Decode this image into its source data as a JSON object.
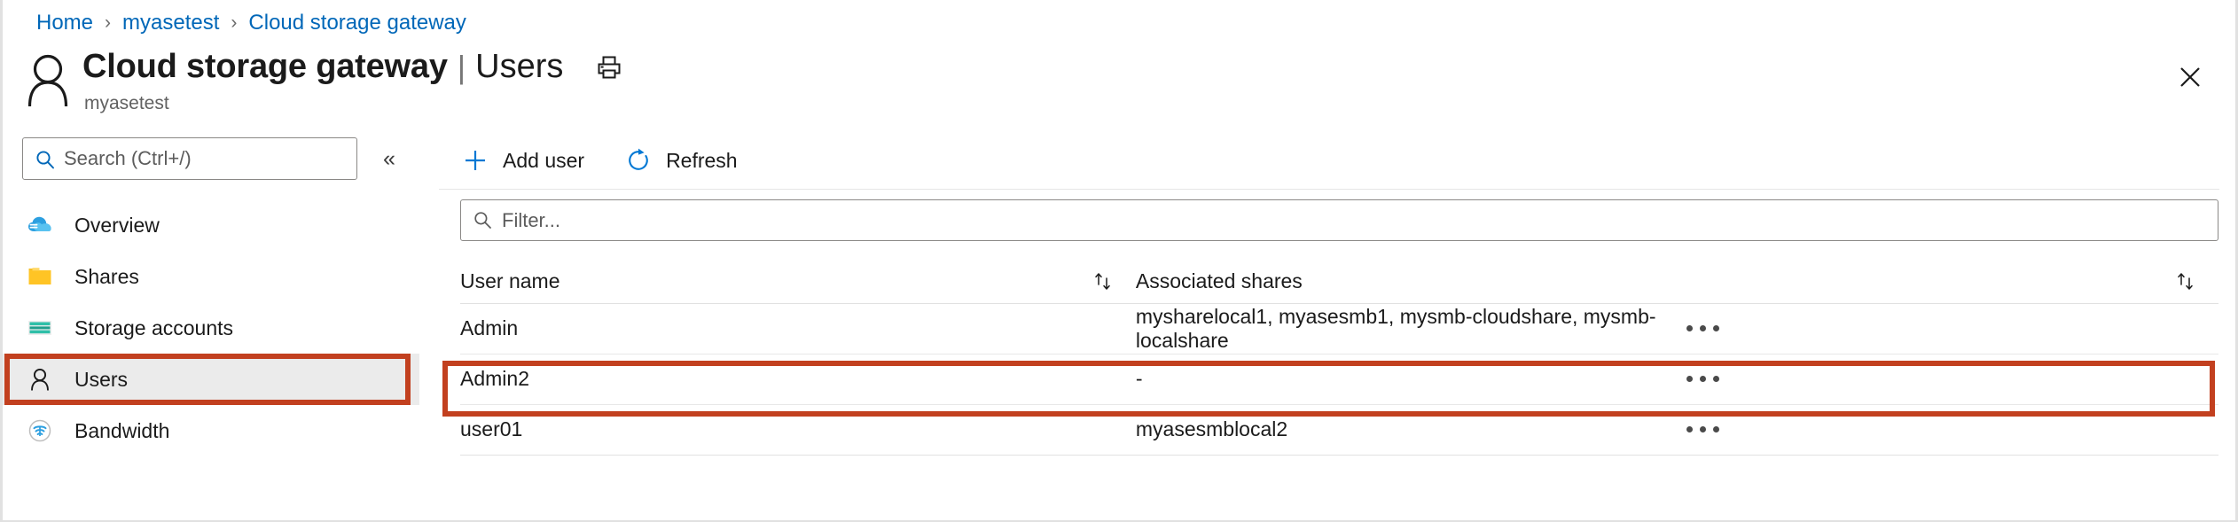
{
  "breadcrumb": {
    "items": [
      {
        "label": "Home"
      },
      {
        "label": "myasetest"
      },
      {
        "label": "Cloud storage gateway"
      }
    ],
    "separator": "›"
  },
  "header": {
    "icon": "user-icon",
    "title": "Cloud storage gateway",
    "title_separator": "|",
    "section": "Users",
    "subtitle": "myasetest",
    "print_icon": "print-icon",
    "close_icon": "close-icon"
  },
  "sidebar": {
    "search": {
      "placeholder": "Search (Ctrl+/)",
      "value": "",
      "icon": "search-icon"
    },
    "collapse": {
      "icon": "chevron-double-left-icon",
      "glyph": "«"
    },
    "items": [
      {
        "label": "Overview",
        "icon": "cloud-icon",
        "selected": false
      },
      {
        "label": "Shares",
        "icon": "folder-icon",
        "selected": false
      },
      {
        "label": "Storage accounts",
        "icon": "storage-account-icon",
        "selected": false
      },
      {
        "label": "Users",
        "icon": "user-icon",
        "selected": true
      },
      {
        "label": "Bandwidth",
        "icon": "bandwidth-icon",
        "selected": false
      }
    ]
  },
  "toolbar": {
    "commands": [
      {
        "label": "Add user",
        "icon": "plus-icon"
      },
      {
        "label": "Refresh",
        "icon": "refresh-icon"
      }
    ]
  },
  "filter": {
    "placeholder": "Filter...",
    "value": "",
    "icon": "search-icon"
  },
  "table": {
    "columns": [
      {
        "label": "User name",
        "sortable": true,
        "sort_icon": "sort-icon"
      },
      {
        "label": "Associated shares",
        "sortable": true,
        "sort_icon": "sort-icon"
      }
    ],
    "rows": [
      {
        "user_name": "Admin",
        "associated_shares": "mysharelocal1, myasesmb1, mysmb-cloudshare, mysmb-localshare",
        "actions_icon": "more-options-icon",
        "highlighted": false
      },
      {
        "user_name": "Admin2",
        "associated_shares": "-",
        "actions_icon": "more-options-icon",
        "highlighted": true
      },
      {
        "user_name": "user01",
        "associated_shares": "myasesmblocal2",
        "actions_icon": "more-options-icon",
        "highlighted": false
      }
    ]
  },
  "annotations": {
    "color": "#c2401f",
    "targets": [
      "sidebar-item-users",
      "table-row-admin2"
    ]
  },
  "colors": {
    "link": "#0067b8",
    "accent": "#0078d4",
    "text": "#1b1b1b",
    "muted": "#616161",
    "selected_bg": "#ebebeb",
    "annotation": "#c2401f"
  }
}
